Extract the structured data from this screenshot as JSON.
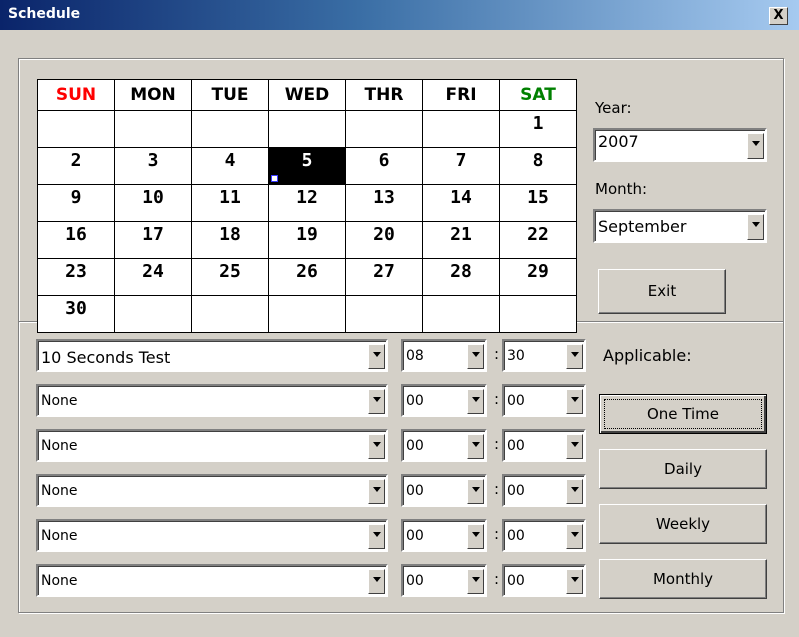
{
  "window": {
    "title": "Schedule",
    "close_label": "X"
  },
  "calendar": {
    "days": [
      {
        "label": "SUN",
        "color": "#ff0000"
      },
      {
        "label": "MON",
        "color": "#000000"
      },
      {
        "label": "TUE",
        "color": "#000000"
      },
      {
        "label": "WED",
        "color": "#000000"
      },
      {
        "label": "THR",
        "color": "#000000"
      },
      {
        "label": "FRI",
        "color": "#000000"
      },
      {
        "label": "SAT",
        "color": "#008000"
      }
    ],
    "weeks": [
      [
        "",
        "",
        "",
        "",
        "",
        "",
        "1"
      ],
      [
        "2",
        "3",
        "4",
        "5",
        "6",
        "7",
        "8"
      ],
      [
        "9",
        "10",
        "11",
        "12",
        "13",
        "14",
        "15"
      ],
      [
        "16",
        "17",
        "18",
        "19",
        "20",
        "21",
        "22"
      ],
      [
        "23",
        "24",
        "25",
        "26",
        "27",
        "28",
        "29"
      ],
      [
        "30",
        "",
        "",
        "",
        "",
        "",
        ""
      ]
    ],
    "selected_day": "5"
  },
  "year": {
    "label": "Year:",
    "value": "2007"
  },
  "month": {
    "label": "Month:",
    "value": "September"
  },
  "exit_button": "Exit",
  "schedules": [
    {
      "task": "10 Seconds Test",
      "hour": "08",
      "minute": "30"
    },
    {
      "task": "None",
      "hour": "00",
      "minute": "00"
    },
    {
      "task": "None",
      "hour": "00",
      "minute": "00"
    },
    {
      "task": "None",
      "hour": "00",
      "minute": "00"
    },
    {
      "task": "None",
      "hour": "00",
      "minute": "00"
    },
    {
      "task": "None",
      "hour": "00",
      "minute": "00"
    }
  ],
  "time_separator": ":",
  "applicable": {
    "label": "Applicable:",
    "buttons": [
      "One Time",
      "Daily",
      "Weekly",
      "Monthly"
    ]
  }
}
